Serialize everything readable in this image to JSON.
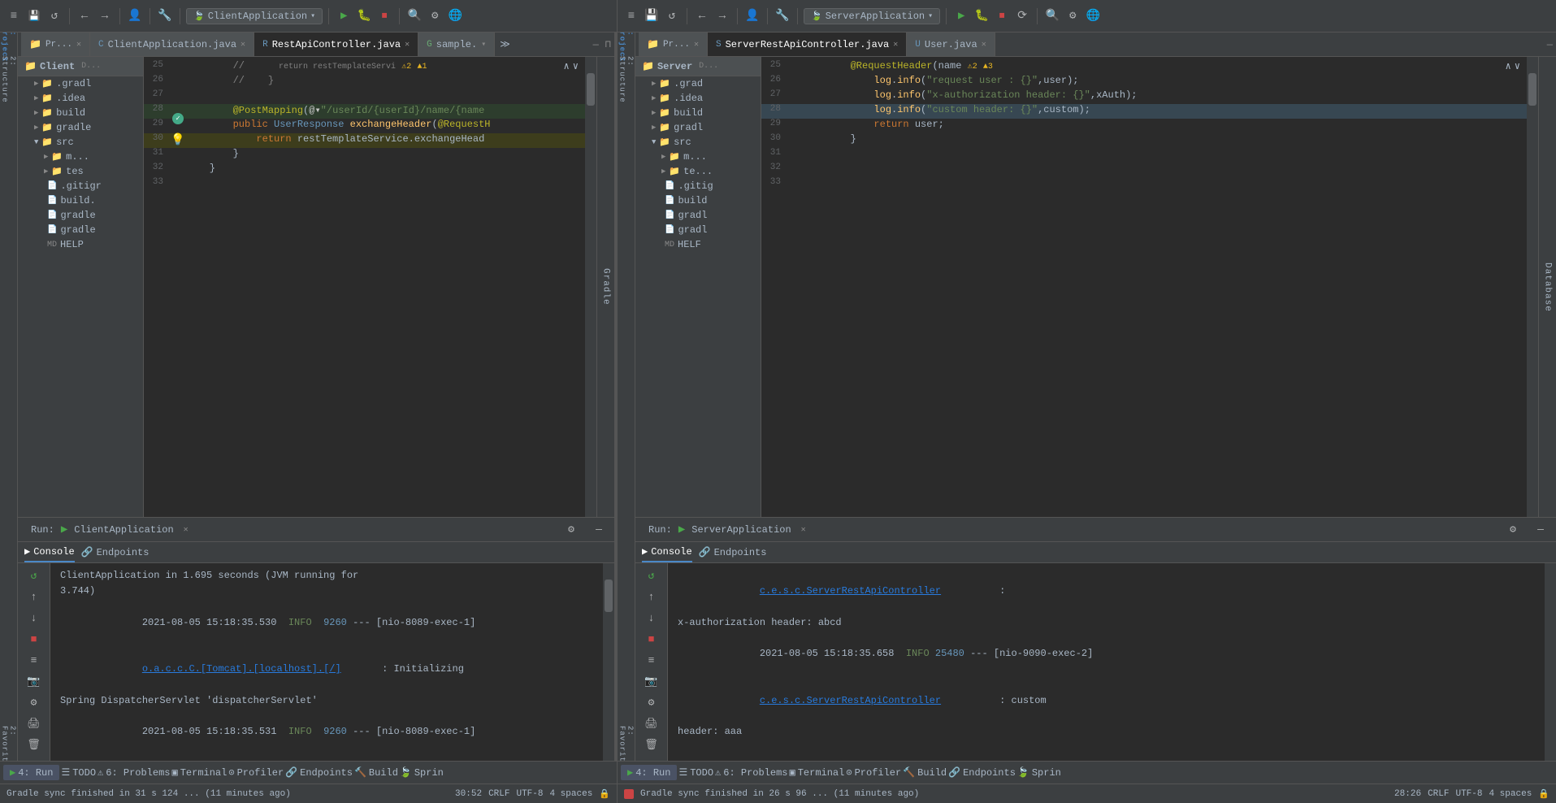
{
  "toolbar": {
    "left_app": "ClientApplication",
    "right_app": "ServerApplication",
    "icons": [
      "≡",
      "💾",
      "↺",
      "←",
      "→",
      "👤",
      "🔧",
      "▶",
      "⏸",
      "⏹",
      "🔍",
      "⚙",
      "🌐"
    ]
  },
  "left_editor": {
    "tabs": [
      {
        "label": "Pr...",
        "type": "project",
        "active": false
      },
      {
        "label": "ClientApplication.java",
        "type": "java",
        "active": false
      },
      {
        "label": "RestApiController.java",
        "type": "java",
        "active": true
      },
      {
        "label": "sample.",
        "type": "groovy",
        "active": false
      }
    ],
    "project_tree": {
      "root": "Client",
      "items": [
        {
          "label": ".gradl",
          "type": "folder",
          "indent": 1
        },
        {
          "label": ".idea",
          "type": "folder",
          "indent": 1
        },
        {
          "label": "build",
          "type": "folder",
          "indent": 1
        },
        {
          "label": "gradle",
          "type": "folder",
          "indent": 1
        },
        {
          "label": "src",
          "type": "folder",
          "indent": 1,
          "expanded": true
        },
        {
          "label": "m...",
          "type": "folder",
          "indent": 2
        },
        {
          "label": "tes",
          "type": "folder",
          "indent": 2
        },
        {
          "label": ".gitigr",
          "type": "file",
          "indent": 1
        },
        {
          "label": "build.",
          "type": "file",
          "indent": 1
        },
        {
          "label": "gradle",
          "type": "file",
          "indent": 1
        },
        {
          "label": "gradle",
          "type": "file",
          "indent": 1
        },
        {
          "label": "HELP",
          "type": "file",
          "indent": 1
        }
      ]
    },
    "code_lines": [
      {
        "num": 25,
        "content": "        //",
        "type": "comment",
        "anno": "return restTemplateServi",
        "warnings": "⚠2 ▲1"
      },
      {
        "num": 26,
        "content": "        //    }",
        "type": "comment"
      },
      {
        "num": 27,
        "content": "",
        "type": "empty"
      },
      {
        "num": 28,
        "content": "        @PostMapping(@▾\"/userId/{userId}/name/{name",
        "type": "code",
        "annotation": "@PostMapping"
      },
      {
        "num": 29,
        "content": "        public UserResponse exchangeHeader(@RequestH",
        "type": "code"
      },
      {
        "num": 30,
        "content": "            return restTemplateService.exchangeHead",
        "type": "code",
        "hint": "💡"
      },
      {
        "num": 31,
        "content": "        }",
        "type": "code"
      },
      {
        "num": 32,
        "content": "    }",
        "type": "code"
      },
      {
        "num": 33,
        "content": "",
        "type": "empty"
      }
    ]
  },
  "right_editor": {
    "tabs": [
      {
        "label": "Pr...",
        "type": "project",
        "active": false
      },
      {
        "label": "ServerRestApiController.java",
        "type": "java",
        "active": true
      },
      {
        "label": "User.java",
        "type": "java",
        "active": false
      }
    ],
    "project_tree": {
      "root": "Server",
      "items": [
        {
          "label": ".grad",
          "type": "folder",
          "indent": 1
        },
        {
          "label": ".idea",
          "type": "folder",
          "indent": 1
        },
        {
          "label": "build",
          "type": "folder",
          "indent": 1
        },
        {
          "label": "gradl",
          "type": "folder",
          "indent": 1
        },
        {
          "label": "src",
          "type": "folder",
          "indent": 1,
          "expanded": true
        },
        {
          "label": "m...",
          "type": "folder",
          "indent": 2
        },
        {
          "label": "te...",
          "type": "folder",
          "indent": 2
        },
        {
          "label": ".gitig",
          "type": "file",
          "indent": 1
        },
        {
          "label": "build",
          "type": "file",
          "indent": 1
        },
        {
          "label": "gradl",
          "type": "file",
          "indent": 1
        },
        {
          "label": "gradl",
          "type": "file",
          "indent": 1
        },
        {
          "label": "HELF",
          "type": "file",
          "indent": 1
        }
      ]
    },
    "code_lines": [
      {
        "num": 25,
        "content": "        @RequestHeader(name ⚠2 ▲3",
        "type": "code",
        "warnings": "⚠2 ▲3"
      },
      {
        "num": 26,
        "content": "            log.info(\"request user : {}\",user);",
        "type": "code"
      },
      {
        "num": 27,
        "content": "            log.info(\"x-authorization header: {}\",xAuth);",
        "type": "code"
      },
      {
        "num": 28,
        "content": "            log.info(\"custom header: {}\",custom);",
        "type": "code",
        "highlighted": true
      },
      {
        "num": 29,
        "content": "            return user;",
        "type": "code"
      },
      {
        "num": 30,
        "content": "        }",
        "type": "code"
      },
      {
        "num": 31,
        "content": "",
        "type": "empty"
      },
      {
        "num": 32,
        "content": "",
        "type": "empty"
      },
      {
        "num": 33,
        "content": "",
        "type": "empty"
      }
    ]
  },
  "left_run": {
    "app_name": "ClientApplication",
    "tabs": [
      {
        "label": "Console",
        "icon": "▶",
        "active": true
      },
      {
        "label": "Endpoints",
        "icon": "🔗",
        "active": false
      }
    ],
    "console_lines": [
      {
        "text": "ClientApplication in 1.695 seconds (JVM running for",
        "type": "normal"
      },
      {
        "text": "3.744)",
        "type": "normal"
      },
      {
        "text": "2021-08-05 15:18:35.530  INFO 9260 --- [nio-8089-exec-1]",
        "type": "info_line"
      },
      {
        "text": "o.a.c.c.C.[Tomcat].[localhost].[/]       : Initializing",
        "type": "link_line",
        "link": "o.a.c.c.C.[Tomcat].[localhost].[/]"
      },
      {
        "text": "Spring DispatcherServlet 'dispatcherServlet'",
        "type": "normal"
      },
      {
        "text": "2021-08-05 15:18:35.531  INFO 9260 --- [nio-8089-exec-1]",
        "type": "info_line"
      },
      {
        "text": "o.s.web.servlet.DispatcherServlet        : Initializing",
        "type": "link_line",
        "link": "o.s.web.servlet.DispatcherServlet"
      }
    ]
  },
  "right_run": {
    "app_name": "ServerApplication",
    "tabs": [
      {
        "label": "Console",
        "icon": "▶",
        "active": true
      },
      {
        "label": "Endpoints",
        "icon": "🔗",
        "active": false
      }
    ],
    "console_lines": [
      {
        "text": "c.e.s.c.ServerRestApiController          :",
        "type": "link_line",
        "link": "c.e.s.c.ServerRestApiController"
      },
      {
        "text": "x-authorization header: abcd",
        "type": "normal"
      },
      {
        "text": "2021-08-05 15:18:35.658  INFO 25480 --- [nio-9090-exec-2]",
        "type": "info_line"
      },
      {
        "text": "c.e.s.c.ServerRestApiController          : custom",
        "type": "link_line",
        "link": "c.e.s.c.ServerRestApiController"
      },
      {
        "text": "header: aaa",
        "type": "normal"
      }
    ]
  },
  "left_status": {
    "sync_text": "Gradle sync finished in 31 s 124 ... (11 minutes ago)",
    "position": "30:52",
    "line_sep": "CRLF",
    "encoding": "UTF-8",
    "indent": "4 spaces"
  },
  "right_status": {
    "sync_text": "Gradle sync finished in 26 s 96 ... (11 minutes ago)",
    "position": "28:26",
    "line_sep": "CRLF",
    "encoding": "UTF-8",
    "indent": "4 spaces"
  },
  "bottom_toolbar_items": [
    {
      "label": "4: Run",
      "icon": "▶"
    },
    {
      "label": "TODO",
      "icon": "☰"
    },
    {
      "label": "6: Problems",
      "icon": "⚠"
    },
    {
      "label": "Terminal",
      "icon": "▣"
    },
    {
      "label": "Profiler",
      "icon": "⊙"
    },
    {
      "label": "Endpoints",
      "icon": "🔗"
    },
    {
      "label": "Build",
      "icon": "🔨"
    },
    {
      "label": "Sprin",
      "icon": "🍃"
    }
  ],
  "right_bottom_toolbar_items": [
    {
      "label": "4: Run",
      "icon": "▶"
    },
    {
      "label": "TODO",
      "icon": "☰"
    },
    {
      "label": "6: Problems",
      "icon": "⚠"
    },
    {
      "label": "Terminal",
      "icon": "▣"
    },
    {
      "label": "Profiler",
      "icon": "⊙"
    },
    {
      "label": "Build",
      "icon": "🔨"
    },
    {
      "label": "Endpoints",
      "icon": "🔗"
    },
    {
      "label": "Sprin",
      "icon": "🍃"
    }
  ]
}
